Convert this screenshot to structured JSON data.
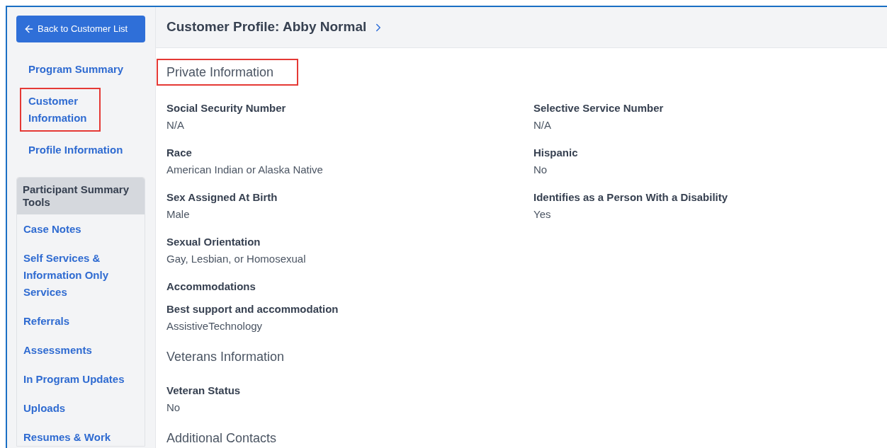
{
  "sidebar": {
    "back_button": "Back to Customer List",
    "nav": [
      {
        "label": "Program Summary",
        "highlighted": false
      },
      {
        "label": "Customer Information",
        "highlighted": true
      },
      {
        "label": "Profile Information",
        "highlighted": false
      }
    ],
    "tools": {
      "title": "Participant Summary Tools",
      "items": [
        "Case Notes",
        "Self Services & Information Only Services",
        "Referrals",
        "Assessments",
        "In Program Updates",
        "Uploads",
        "Resumes & Work"
      ]
    }
  },
  "header": {
    "title": "Customer Profile: Abby Normal"
  },
  "sections": [
    {
      "title": "Private Information",
      "highlighted": true,
      "rows": [
        {
          "kind": "fields",
          "fields": [
            {
              "label": "Social Security Number",
              "value": "N/A"
            },
            {
              "label": "Selective Service Number",
              "value": "N/A"
            }
          ]
        },
        {
          "kind": "fields",
          "fields": [
            {
              "label": "Race",
              "value": "American Indian or Alaska Native"
            },
            {
              "label": "Hispanic",
              "value": "No"
            }
          ]
        },
        {
          "kind": "fields",
          "fields": [
            {
              "label": "Sex Assigned At Birth",
              "value": "Male"
            },
            {
              "label": "Identifies as a Person With a Disability",
              "value": "Yes"
            }
          ]
        },
        {
          "kind": "fields",
          "fields": [
            {
              "label": "Sexual Orientation",
              "value": "Gay, Lesbian, or Homosexual"
            }
          ]
        },
        {
          "kind": "subheading",
          "text": "Accommodations"
        },
        {
          "kind": "fields",
          "fields": [
            {
              "label": "Best support and accommodation",
              "value": "AssistiveTechnology"
            }
          ]
        }
      ]
    },
    {
      "title": "Veterans Information",
      "highlighted": false,
      "rows": [
        {
          "kind": "fields",
          "fields": [
            {
              "label": "Veteran Status",
              "value": "No"
            }
          ]
        }
      ]
    },
    {
      "title": "Additional Contacts",
      "highlighted": false
    }
  ]
}
